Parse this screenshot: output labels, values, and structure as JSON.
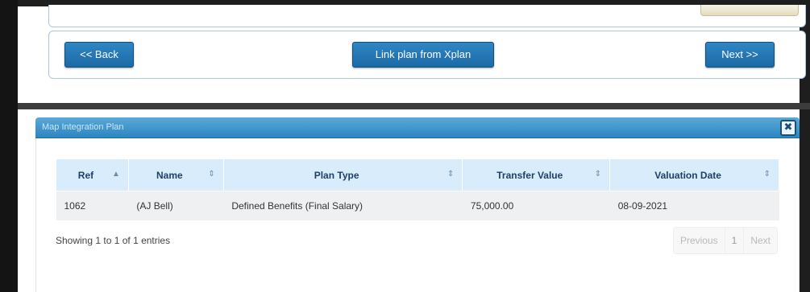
{
  "nav_buttons": {
    "back_label": "<< Back",
    "link_label": "Link plan from Xplan",
    "next_label": "Next >>"
  },
  "dialog": {
    "title": "Map Integration Plan",
    "close_glyph": "✖"
  },
  "table": {
    "columns": [
      {
        "label": "Ref",
        "sort": "▲"
      },
      {
        "label": "Name",
        "sort": "⇕"
      },
      {
        "label": "Plan Type",
        "sort": "⇕"
      },
      {
        "label": "Transfer Value",
        "sort": "⇕"
      },
      {
        "label": "Valuation Date",
        "sort": "⇕"
      }
    ],
    "rows": [
      [
        "1062",
        "(AJ Bell)",
        "Defined Benefits (Final Salary)",
        "75,000.00",
        "08-09-2021"
      ]
    ]
  },
  "footer": {
    "info": "Showing 1 to 1 of 1 entries",
    "pager": {
      "previous": "Previous",
      "page": "1",
      "next": "Next"
    }
  },
  "colors": {
    "button": "#1c6aa6",
    "title_bar": "#2d85c0",
    "header_bg": "#d9ecfb"
  }
}
